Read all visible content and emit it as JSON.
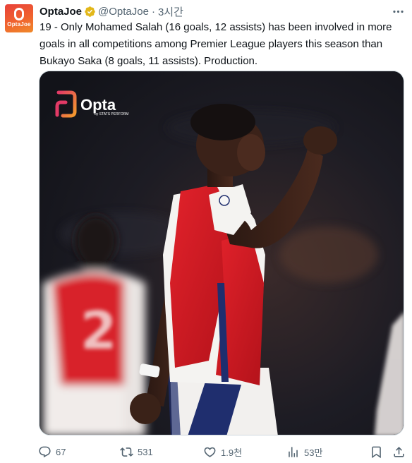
{
  "tweet": {
    "avatar_text": "OptaJoe",
    "display_name": "OptaJoe",
    "handle": "@OptaJoe",
    "separator": "·",
    "time": "3시간",
    "text": "19 - Only Mohamed Salah (16 goals, 12 assists) has been involved in more goals in all competitions among Premier League players this season than Bukayo Saka (8 goals, 11 assists). Production.",
    "media": {
      "logo_text": "Opta",
      "logo_subtext": "by STATS PERFORM",
      "shirt_number_back": "2"
    },
    "actions": {
      "replies": "67",
      "reposts": "531",
      "likes": "1.9천",
      "views": "53만"
    }
  },
  "colors": {
    "brand_orange": "#f0632f",
    "verified_gold": "#e2b719",
    "arsenal_red": "#d71920",
    "text_secondary": "#536471"
  },
  "icons": {
    "verified": "verified-badge-icon",
    "more": "more-icon",
    "reply": "reply-icon",
    "repost": "repost-icon",
    "like": "heart-icon",
    "views": "views-icon",
    "bookmark": "bookmark-icon",
    "share": "share-icon"
  }
}
